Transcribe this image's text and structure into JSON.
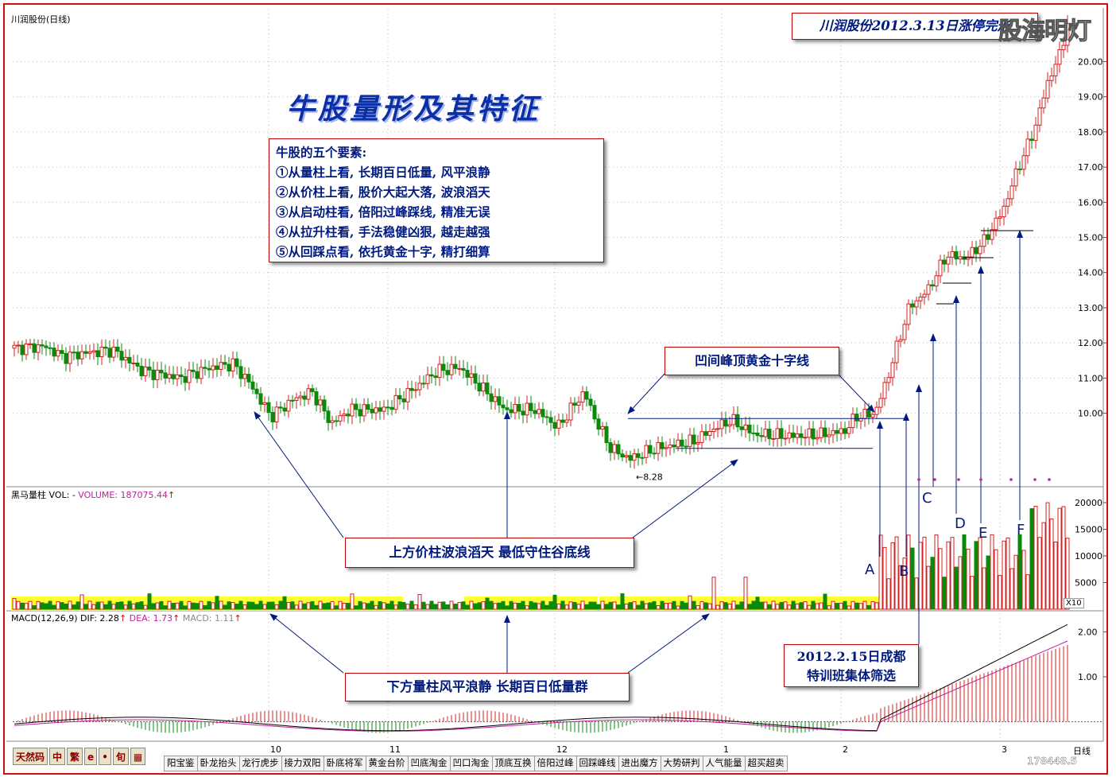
{
  "chart_title": "川润股份(日线)",
  "main_title": "牛股量形及其特征",
  "elements": {
    "heading": "牛股的五个要素:",
    "items": [
      "①从量柱上看, 长期百日低量, 风平浪静",
      "②从价柱上看, 股价大起大落, 波浪滔天",
      "③从启动柱看, 倍阳过峰踩线, 精准无误",
      "④从拉升柱看, 手法稳健凶狠, 越走越强",
      "⑤从回踩点看, 依托黄金十字, 精打细算"
    ]
  },
  "annotations": {
    "gold_cross": "凹间峰顶黄金十字线",
    "price_note": "上方价柱波浪滔天 最低守住谷底线",
    "volume_note": "下方量柱风平浪静 长期百日低量群",
    "date_note_line1": "2012.2.15日成都",
    "date_note_line2": "特训班集体筛选",
    "limit_note": "川润股份2012.3.13日涨停完形",
    "watermark": "股海明灯",
    "low_price": "8.28",
    "points": [
      "A",
      "B",
      "C",
      "D",
      "E",
      "F"
    ]
  },
  "volume_header": {
    "name": "黑马量柱",
    "vol": "VOL: -",
    "value": "VOLUME: 187075.44"
  },
  "macd_header": {
    "name": "MACD(12,26,9)",
    "dif": "DIF: 2.28",
    "dea": "DEA: 1.73",
    "macd": "MACD: 1.11"
  },
  "vol_multiplier": "X10",
  "period_label": "日线",
  "corner_number": "178448.5",
  "toolbar": [
    "天然码",
    "中",
    "繁",
    "e",
    "•",
    "旬",
    "▦"
  ],
  "tabs": [
    "阳宝鉴",
    "卧龙抬头",
    "龙行虎步",
    "接力双阳",
    "卧底将军",
    "黄金台阶",
    "凹底淘金",
    "凹口淘金",
    "顶底互换",
    "倍阳过峰",
    "回踩峰线",
    "进出魔方",
    "大势研判",
    "人气能量",
    "超买超卖"
  ],
  "colors": {
    "up": "#d42020",
    "down": "#0a8a0a",
    "highlight": "#ffff33",
    "annot": "#001a80",
    "border": "#c00000"
  },
  "chart_data": {
    "type": "candlestick",
    "title": "川润股份(日线)",
    "price_axis": {
      "ticks": [
        10,
        11,
        12,
        13,
        14,
        15,
        16,
        17,
        18,
        19,
        20
      ],
      "tick_labels": [
        "10.00",
        "11.00",
        "12.00",
        "13.00",
        "14.00",
        "15.00",
        "16.00",
        "17.00",
        "18.00",
        "19.00",
        "20.00"
      ],
      "range": [
        8.0,
        21.3
      ]
    },
    "volume_axis": {
      "ticks": [
        5000,
        10000,
        15000,
        20000
      ],
      "tick_labels": [
        "5000",
        "10000",
        "15000",
        "20000"
      ],
      "range": [
        0,
        20000
      ],
      "multiplier": "X10"
    },
    "macd_axis": {
      "ticks": [
        1,
        2
      ],
      "tick_labels": [
        "1.00",
        "2.00"
      ],
      "range": [
        -0.4,
        2.4
      ]
    },
    "month_labels": [
      {
        "label": "10",
        "index": 64
      },
      {
        "label": "11",
        "index": 94
      },
      {
        "label": "12",
        "index": 136
      },
      {
        "label": "1",
        "index": 178
      },
      {
        "label": "2",
        "index": 208
      },
      {
        "label": "3",
        "index": 248
      }
    ],
    "gold_cross_price": 9.85,
    "valley_floor_price": 9.0,
    "low_price": 8.28,
    "candles": []
  }
}
